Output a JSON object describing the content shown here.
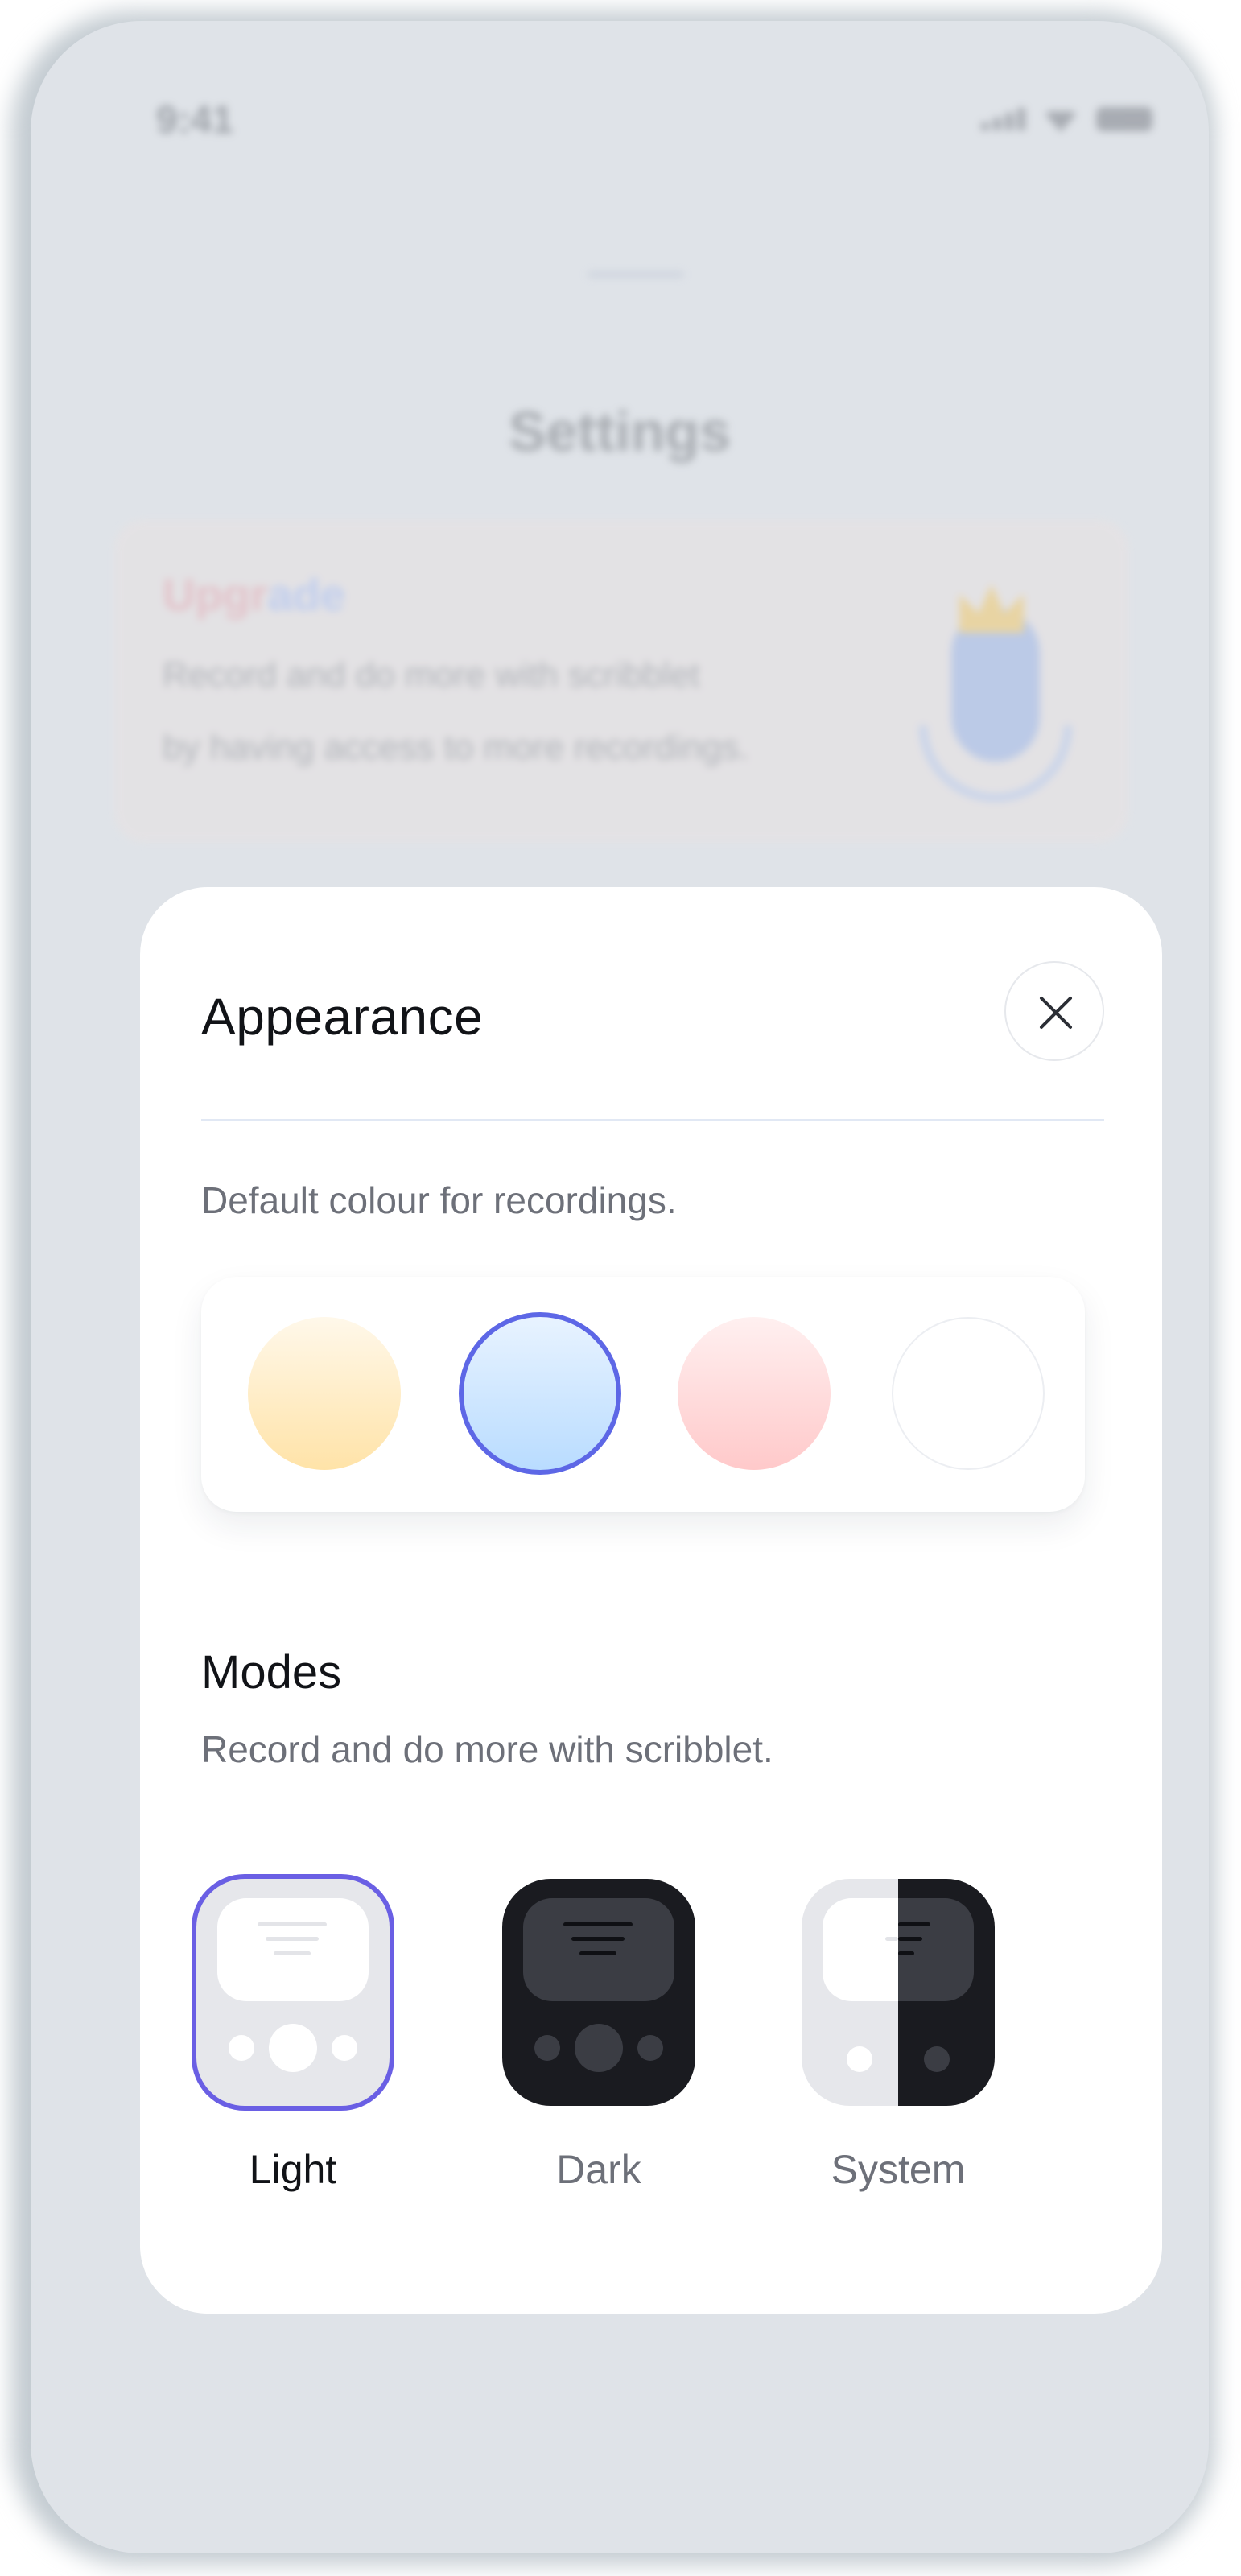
{
  "status_bar": {
    "time": "9:41"
  },
  "background": {
    "title": "Settings",
    "upgrade": {
      "title_part1": "Upgr",
      "title_part2": "ade",
      "line1": "Record and do more with scribblet",
      "line2": "by having access to more recordings."
    }
  },
  "sheet": {
    "title": "Appearance",
    "colour_label": "Default colour for recordings.",
    "swatches": [
      {
        "name": "yellow",
        "color": "#ffe3a8"
      },
      {
        "name": "blue",
        "color": "#b9dcff",
        "selected": true
      },
      {
        "name": "pink",
        "color": "#ffc9ca"
      },
      {
        "name": "white",
        "color": "#ffffff"
      }
    ],
    "modes_title": "Modes",
    "modes_subtitle": "Record and do more with scribblet.",
    "modes": [
      {
        "label": "Light",
        "selected": true
      },
      {
        "label": "Dark",
        "selected": false
      },
      {
        "label": "System",
        "selected": false
      }
    ]
  },
  "colors": {
    "accent": "#5d67e6",
    "text_primary": "#111317",
    "text_secondary": "#6d7079"
  }
}
